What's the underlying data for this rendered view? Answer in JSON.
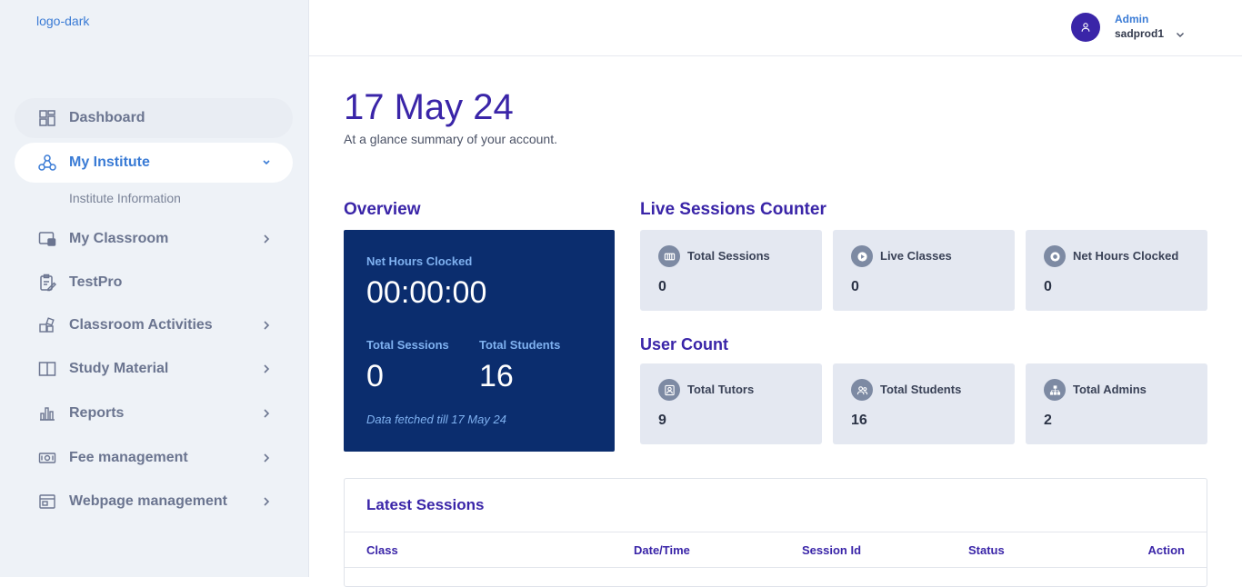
{
  "sidebar": {
    "logo_alt": "logo-dark",
    "items": [
      {
        "label": "Dashboard"
      },
      {
        "label": "My Institute"
      },
      {
        "label": "My Classroom"
      },
      {
        "label": "TestPro"
      },
      {
        "label": "Classroom Activities"
      },
      {
        "label": "Study Material"
      },
      {
        "label": "Reports"
      },
      {
        "label": "Fee management"
      },
      {
        "label": "Webpage management"
      }
    ],
    "subitem": "Institute Information"
  },
  "header": {
    "role": "Admin",
    "username": "sadprod1"
  },
  "main": {
    "date": "17 May 24",
    "subtitle": "At a glance summary of your account."
  },
  "overview": {
    "title": "Overview",
    "net_hours_label": "Net Hours Clocked",
    "net_hours_value": "00:00:00",
    "total_sessions_label": "Total Sessions",
    "total_sessions_value": "0",
    "total_students_label": "Total Students",
    "total_students_value": "16",
    "note": "Data fetched till 17 May 24"
  },
  "live_sessions": {
    "title": "Live Sessions Counter",
    "cards": [
      {
        "label": "Total Sessions",
        "value": "0"
      },
      {
        "label": "Live Classes",
        "value": "0"
      },
      {
        "label": "Net Hours Clocked",
        "value": "0"
      }
    ]
  },
  "user_count": {
    "title": "User Count",
    "cards": [
      {
        "label": "Total Tutors",
        "value": "9"
      },
      {
        "label": "Total Students",
        "value": "16"
      },
      {
        "label": "Total Admins",
        "value": "2"
      }
    ]
  },
  "latest_sessions": {
    "title": "Latest Sessions",
    "columns": [
      "Class",
      "Date/Time",
      "Session Id",
      "Status",
      "Action"
    ]
  },
  "colors": {
    "accent": "#3a25a8",
    "link": "#3a7bd5",
    "overview_bg": "#0b2d6e"
  }
}
